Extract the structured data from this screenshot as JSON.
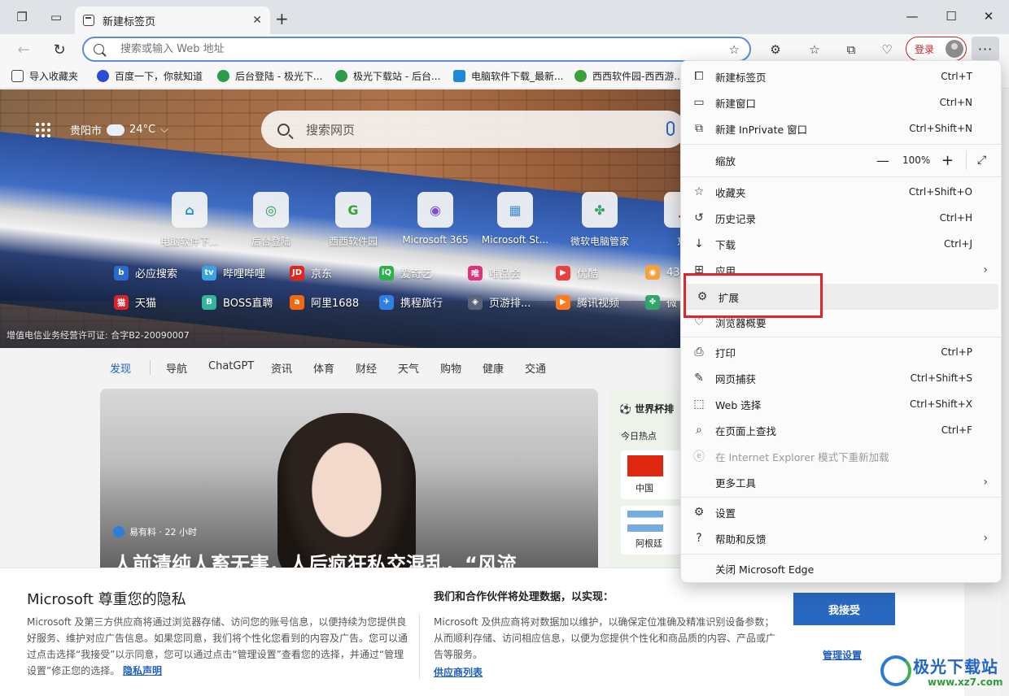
{
  "browser": {
    "tab_title": "新建标签页",
    "address_placeholder": "搜索或输入 Web 地址",
    "login_label": "登录"
  },
  "favorites": [
    {
      "label": "导入收藏夹",
      "color": "#444444"
    },
    {
      "label": "百度一下，你就知道",
      "color": "#2d49d6"
    },
    {
      "label": "后台登陆 - 极光下...",
      "color": "#2a9c4a"
    },
    {
      "label": "极光下载站 - 后台...",
      "color": "#2a9c4a"
    },
    {
      "label": "电脑软件下载_最新...",
      "color": "#1c8ad6"
    },
    {
      "label": "西西软件园-西西游...",
      "color": "#3aa13a"
    }
  ],
  "hero": {
    "city": "贵阳市",
    "temp": "24°C",
    "search_placeholder": "搜索网页",
    "tiles": [
      "电脑软件下...",
      "后台登陆",
      "西西软件园",
      "Microsoft 365",
      "Microsoft St...",
      "微软电脑管家",
      "京"
    ],
    "quick_row1": [
      "必应搜索",
      "哔哩哔哩",
      "京东",
      "爱奇艺",
      "唯品会",
      "优酷",
      "43"
    ],
    "quick_row2": [
      "天猫",
      "BOSS直聘",
      "阿里1688",
      "携程旅行",
      "页游排...",
      "腾讯视频",
      "微"
    ],
    "icp": "增值电信业务经营许可证: 合字B2-20090007"
  },
  "feed_nav": [
    "发现",
    "导航",
    "ChatGPT",
    "资讯",
    "体育",
    "财经",
    "天气",
    "购物",
    "健康",
    "交通"
  ],
  "feed": {
    "source": "易有料 · 22 小时",
    "headline": "人前清纯人畜无害，人后疯狂私交混乱，“风流",
    "side_title": "世界杯排",
    "side_sub": "今日热点",
    "team1": "中国",
    "team2": "阿根廷"
  },
  "menu": {
    "new_tab": {
      "label": "新建标签页",
      "shortcut": "Ctrl+T"
    },
    "new_window": {
      "label": "新建窗口",
      "shortcut": "Ctrl+N"
    },
    "new_private": {
      "label": "新建 InPrivate 窗口",
      "shortcut": "Ctrl+Shift+N"
    },
    "zoom": {
      "label": "缩放",
      "value": "100%"
    },
    "favorites": {
      "label": "收藏夹",
      "shortcut": "Ctrl+Shift+O"
    },
    "history": {
      "label": "历史记录",
      "shortcut": "Ctrl+H"
    },
    "downloads": {
      "label": "下载",
      "shortcut": "Ctrl+J"
    },
    "apps": {
      "label": "应用"
    },
    "extensions": {
      "label": "扩展"
    },
    "essentials": {
      "label": "浏览器概要"
    },
    "print": {
      "label": "打印",
      "shortcut": "Ctrl+P"
    },
    "capture": {
      "label": "网页捕获",
      "shortcut": "Ctrl+Shift+S"
    },
    "web_select": {
      "label": "Web 选择",
      "shortcut": "Ctrl+Shift+X"
    },
    "find": {
      "label": "在页面上查找",
      "shortcut": "Ctrl+F"
    },
    "ie_mode": {
      "label": "在 Internet Explorer 模式下重新加载"
    },
    "more_tools": {
      "label": "更多工具"
    },
    "settings": {
      "label": "设置"
    },
    "help": {
      "label": "帮助和反馈"
    },
    "close": {
      "label": "关闭 Microsoft Edge"
    }
  },
  "privacy": {
    "title": "Microsoft 尊重您的隐私",
    "body": "Microsoft 及第三方供应商将通过浏览器存储、访问您的账号信息，以便持续为您提供良好服务、维护对应广告信息。如果您同意，我们将个性化您看到的内容及广告。您可以通过点击选择“我接受”以示同意，您可以通过点击“管理设置”查看您的选择，并通过“管理设置”修正您的选择。",
    "privacy_link": "隐私声明",
    "subtitle": "我们和合作伙伴将处理数据，以实现：",
    "body2": "Microsoft 及供应商将对数据加以维护，以确保定位准确及精准识别设备参数；从而顺利存储、访问相应信息，以便为您提供个性化和商品质的内容、产品或广告等服务。",
    "vendor_link": "供应商列表",
    "accept": "我接受",
    "manage": "管理设置"
  },
  "watermark": {
    "name": "极光下载站",
    "url": "www.xz7.com"
  },
  "colors": {
    "accent": "#2868c0",
    "login_red": "#c4262e",
    "highlight": "#e0242c"
  }
}
